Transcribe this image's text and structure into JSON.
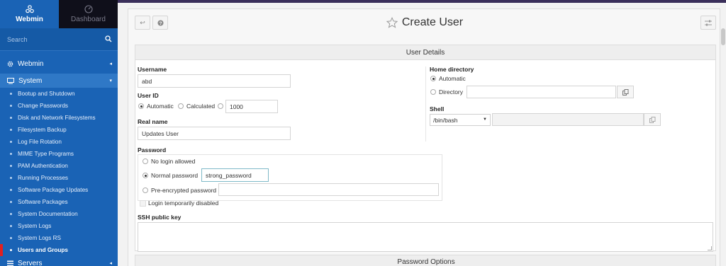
{
  "sidebar": {
    "tabs": [
      {
        "label": "Webmin",
        "icon": "webmin-logo-icon"
      },
      {
        "label": "Dashboard",
        "icon": "dashboard-gauge-icon"
      }
    ],
    "search_placeholder": "Search",
    "sections": {
      "webmin": "Webmin",
      "system": "System",
      "servers": "Servers"
    },
    "system_items": [
      "Bootup and Shutdown",
      "Change Passwords",
      "Disk and Network Filesystems",
      "Filesystem Backup",
      "Log File Rotation",
      "MIME Type Programs",
      "PAM Authentication",
      "Running Processes",
      "Software Package Updates",
      "Software Packages",
      "System Documentation",
      "System Logs",
      "System Logs RS",
      "Users and Groups"
    ],
    "active_item": "Users and Groups"
  },
  "page": {
    "title": "Create User"
  },
  "user_details": {
    "heading": "User Details",
    "username_label": "Username",
    "username_value": "abd",
    "userid_label": "User ID",
    "userid_options": [
      "Automatic",
      "Calculated"
    ],
    "userid_value": "1000",
    "realname_label": "Real name",
    "realname_value": "Updates User",
    "homedir_label": "Home directory",
    "homedir_options": [
      "Automatic",
      "Directory"
    ],
    "shell_label": "Shell",
    "shell_value": "/bin/bash",
    "password_label": "Password",
    "password_options": [
      "No login allowed",
      "Normal password",
      "Pre-encrypted password"
    ],
    "password_value": "strong_password",
    "login_disabled_label": "Login temporarily disabled",
    "ssh_label": "SSH public key"
  },
  "password_options": {
    "heading": "Password Options"
  },
  "colors": {
    "sidebar_bg": "#1a63b5",
    "sidebar_active_marker": "#e02020",
    "page_bg": "#f2f2f2"
  }
}
